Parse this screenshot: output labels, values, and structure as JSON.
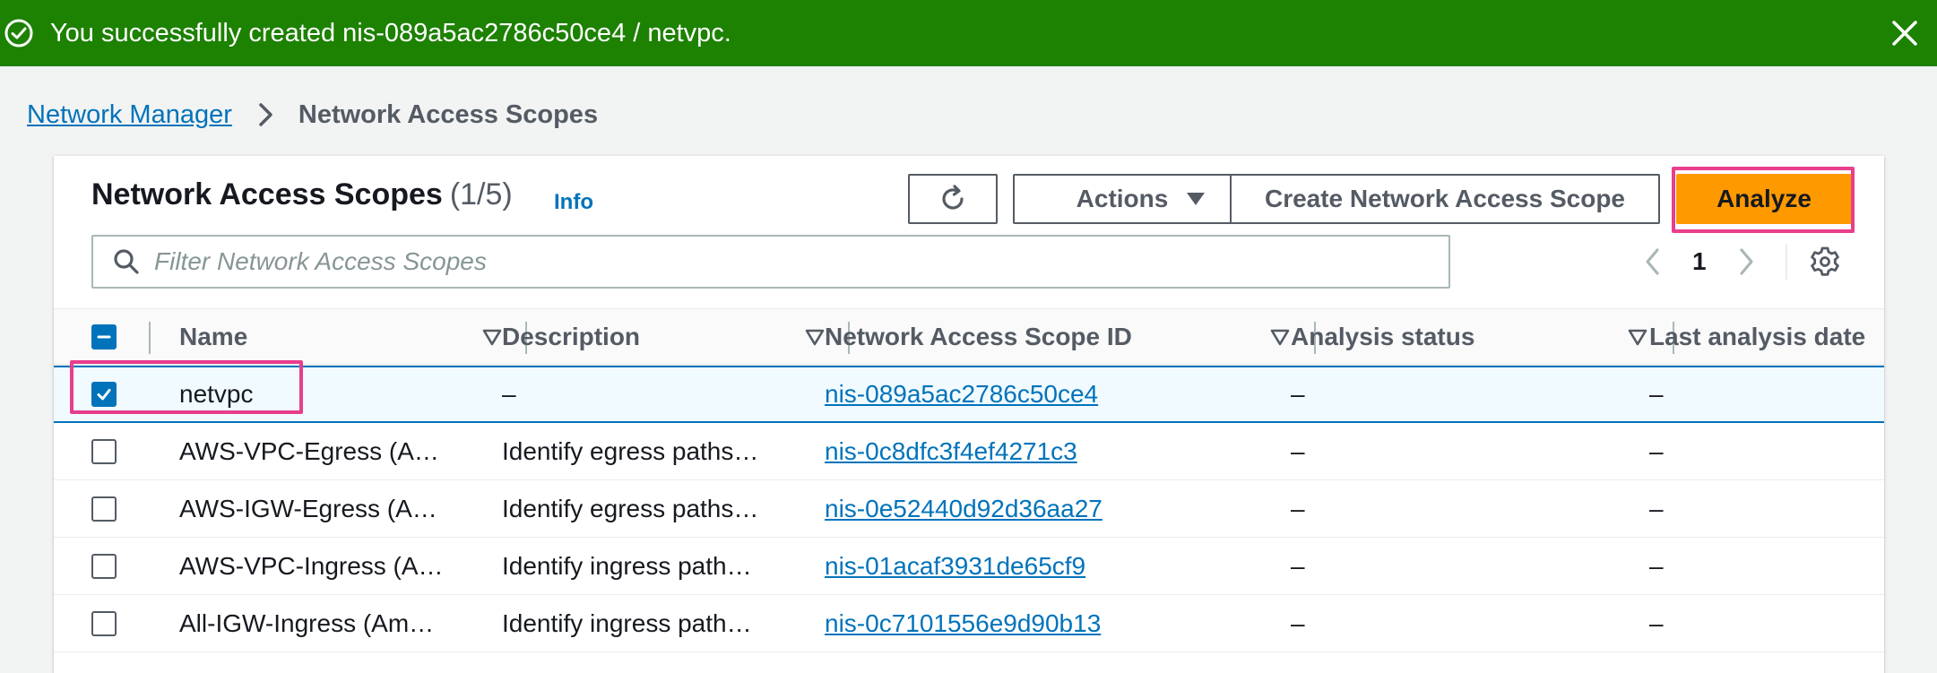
{
  "flash": {
    "message": "You successfully created nis-089a5ac2786c50ce4 / netvpc.",
    "color": "#1d8102"
  },
  "breadcrumb": {
    "parent": "Network Manager",
    "current": "Network Access Scopes"
  },
  "panel": {
    "title": "Network Access Scopes",
    "count": "(1/5)",
    "info_label": "Info"
  },
  "toolbar": {
    "actions_label": "Actions",
    "create_label": "Create Network Access Scope",
    "analyze_label": "Analyze",
    "accent": "#ff9900"
  },
  "search": {
    "placeholder": "Filter Network Access Scopes",
    "value": ""
  },
  "pagination": {
    "current_page": "1"
  },
  "table": {
    "columns": [
      "Name",
      "Description",
      "Network Access Scope ID",
      "Analysis status",
      "Last analysis date"
    ],
    "rows": [
      {
        "selected": true,
        "name": "netvpc",
        "description": "–",
        "scope_id": "nis-089a5ac2786c50ce4",
        "analysis_status": "–",
        "last_analysis_date": "–"
      },
      {
        "selected": false,
        "name": "AWS-VPC-Egress (A…",
        "description": "Identify egress paths…",
        "scope_id": "nis-0c8dfc3f4ef4271c3",
        "analysis_status": "–",
        "last_analysis_date": "–"
      },
      {
        "selected": false,
        "name": "AWS-IGW-Egress (A…",
        "description": "Identify egress paths…",
        "scope_id": "nis-0e52440d92d36aa27",
        "analysis_status": "–",
        "last_analysis_date": "–"
      },
      {
        "selected": false,
        "name": "AWS-VPC-Ingress (A…",
        "description": "Identify ingress path…",
        "scope_id": "nis-01acaf3931de65cf9",
        "analysis_status": "–",
        "last_analysis_date": "–"
      },
      {
        "selected": false,
        "name": "All-IGW-Ingress (Am…",
        "description": "Identify ingress path…",
        "scope_id": "nis-0c7101556e9d90b13",
        "analysis_status": "–",
        "last_analysis_date": "–"
      }
    ]
  },
  "icons": {
    "flash": "check-circle-icon",
    "close": "close-icon",
    "breadcrumb_separator": "chevron-right-icon",
    "refresh": "refresh-icon",
    "actions_caret": "caret-down-icon",
    "search": "search-icon",
    "prev": "chevron-left-icon",
    "next": "chevron-right-icon",
    "settings": "gear-icon",
    "sort": "sort-caret-icon"
  }
}
